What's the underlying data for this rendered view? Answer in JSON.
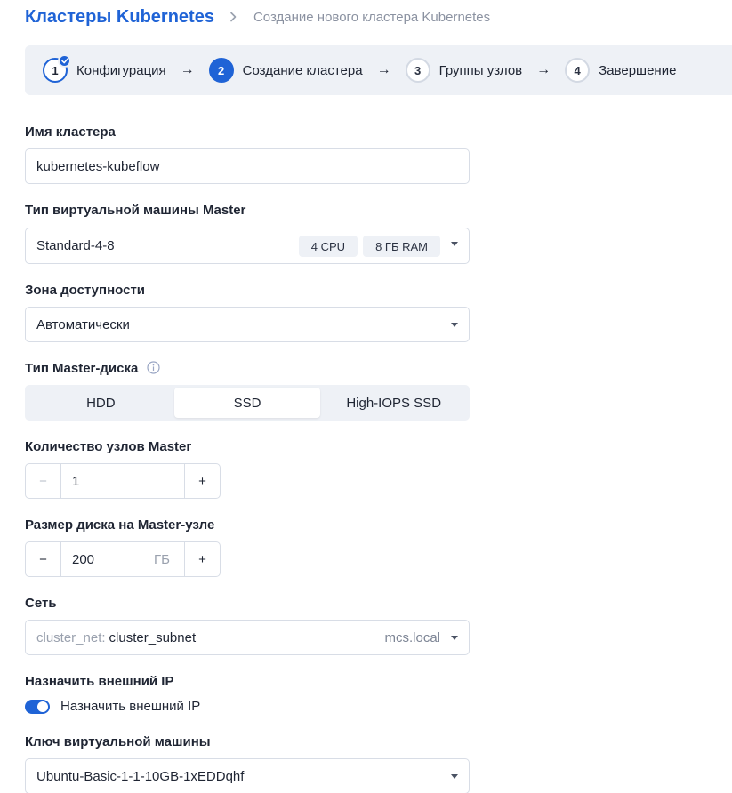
{
  "header": {
    "title": "Кластеры Kubernetes",
    "breadcrumb_current": "Создание нового кластера Kubernetes"
  },
  "stepper": {
    "steps": [
      {
        "num": "1",
        "label": "Конфигурация",
        "state": "done"
      },
      {
        "num": "2",
        "label": "Создание кластера",
        "state": "active"
      },
      {
        "num": "3",
        "label": "Группы узлов",
        "state": "pending"
      },
      {
        "num": "4",
        "label": "Завершение",
        "state": "pending"
      }
    ],
    "arrow": "→"
  },
  "form": {
    "cluster_name": {
      "label": "Имя кластера",
      "value": "kubernetes-kubeflow"
    },
    "master_vm_type": {
      "label": "Тип виртуальной машины Master",
      "value": "Standard-4-8",
      "cpu": "4 CPU",
      "ram": "8 ГБ RAM"
    },
    "zone": {
      "label": "Зона доступности",
      "value": "Автоматически"
    },
    "disk_type": {
      "label": "Тип Master-диска",
      "options": [
        "HDD",
        "SSD",
        "High-IOPS SSD"
      ],
      "selected": "SSD"
    },
    "master_count": {
      "label": "Количество узлов Master",
      "value": "1",
      "minus": "−",
      "plus": "+"
    },
    "disk_size": {
      "label": "Размер диска на Master-узле",
      "value": "200",
      "unit": "ГБ",
      "minus": "−",
      "plus": "+"
    },
    "network": {
      "label": "Сеть",
      "prefix": "cluster_net:",
      "value": "cluster_subnet",
      "domain": "mcs.local"
    },
    "external_ip": {
      "label": "Назначить внешний IP",
      "toggle_label": "Назначить внешний IP",
      "enabled": true
    },
    "vm_key": {
      "label": "Ключ виртуальной машины",
      "value": "Ubuntu-Basic-1-1-10GB-1xEDDqhf"
    }
  },
  "colors": {
    "accent": "#1f63d6",
    "panel": "#eef1f6",
    "border": "#d8dde6"
  }
}
